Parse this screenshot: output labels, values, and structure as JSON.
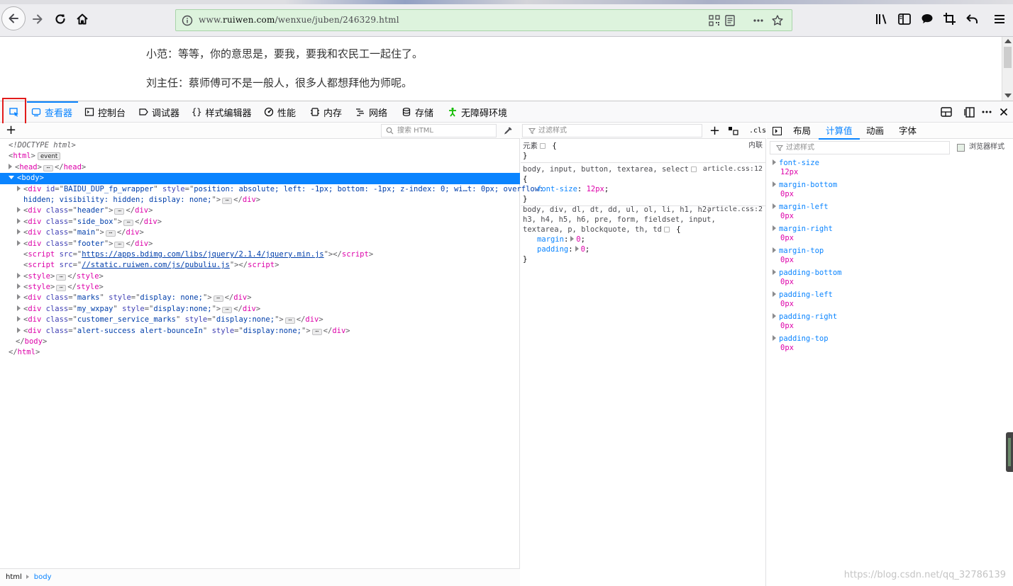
{
  "browser": {
    "url_prefix": "www.",
    "url_domain": "ruiwen.com",
    "url_path": "/wenxue/juben/246329.html"
  },
  "page": {
    "line1": "小范：等等，你的意思是，要我，要我和农民工一起住了。",
    "line2": "刘主任：蔡师傅可不是一般人，很多人都想拜他为师呢。"
  },
  "devtools": {
    "tabs": {
      "inspector": "查看器",
      "console": "控制台",
      "debugger": "调试器",
      "style_editor": "样式编辑器",
      "performance": "性能",
      "memory": "内存",
      "network": "网络",
      "storage": "存储",
      "accessibility": "无障碍环境"
    },
    "markup": {
      "search_placeholder": "搜索 HTML",
      "doctype": "<!DOCTYPE html>",
      "event_badge": "event",
      "ellipsis": "⋯",
      "baidu_id": "BAIDU_DUP_fp_wrapper",
      "baidu_style_1": "position: absolute; left: -1px; bottom: -1px; z-index: 0; wi…t: 0px; overflow:",
      "baidu_style_2": "hidden; visibility: hidden; display: none;",
      "class_header": "header",
      "class_side_box": "side_box",
      "class_main": "main",
      "class_footer": "footer",
      "script1_src": "https://apps.bdimg.com/libs/jquery/2.1.4/jquery.min.js",
      "script2_src": "//static.ruiwen.com/js/pubuliu.js",
      "class_marks": "marks",
      "style_marks": "display: none;",
      "class_wxpay": "my_wxpay",
      "style_wxpay": "display:none;",
      "class_service": "customer_service_marks",
      "style_service": "display:none;",
      "class_alert": "alert-success alert-bounceIn",
      "style_alert": "display:none;"
    },
    "breadcrumb": {
      "items": [
        "html",
        "body"
      ]
    },
    "rules": {
      "filter_placeholder": "过滤样式",
      "cls_label": ".cls",
      "element_label": "元素",
      "inline_label": "内联",
      "rule1_selector": "body, input, button, textarea, select",
      "rule1_source": "article.css:12",
      "rule1_prop": "font-size",
      "rule1_value": "12px",
      "rule2_selector_1": "body, div, dl, dt, dd, ul, ol, li, h1, h2,",
      "rule2_selector_2": "h3, h4, h5, h6, pre, form, fieldset, input,",
      "rule2_selector_3": "textarea, p, blockquote, th, td",
      "rule2_source": "article.css:2",
      "rule2_prop1": "margin",
      "rule2_val1": "0",
      "rule2_prop2": "padding",
      "rule2_val2": "0"
    },
    "side_tabs": {
      "layout": "布局",
      "computed": "计算值",
      "animations": "动画",
      "fonts": "字体"
    },
    "computed": {
      "filter_placeholder": "过滤样式",
      "browser_styles_label": "浏览器样式",
      "props": [
        {
          "name": "font-size",
          "value": "12px"
        },
        {
          "name": "margin-bottom",
          "value": "0px"
        },
        {
          "name": "margin-left",
          "value": "0px"
        },
        {
          "name": "margin-right",
          "value": "0px"
        },
        {
          "name": "margin-top",
          "value": "0px"
        },
        {
          "name": "padding-bottom",
          "value": "0px"
        },
        {
          "name": "padding-left",
          "value": "0px"
        },
        {
          "name": "padding-right",
          "value": "0px"
        },
        {
          "name": "padding-top",
          "value": "0px"
        }
      ]
    }
  },
  "watermark": "https://blog.csdn.net/qq_32786139",
  "colors": {
    "accent": "#0a84ff",
    "urlbar_bg": "#ddf3dd",
    "highlight_box": "#e21c1c"
  }
}
